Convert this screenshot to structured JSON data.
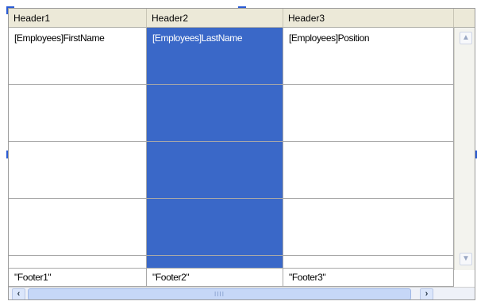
{
  "grid": {
    "headers": [
      "Header1",
      "Header2",
      "Header3"
    ],
    "detail": [
      "[Employees]FirstName",
      "[Employees]LastName",
      "[Employees]Position"
    ],
    "footers": [
      "\"Footer1\"",
      "\"Footer2\"",
      "\"Footer3\""
    ],
    "selected_column": 2
  },
  "scrollbar": {
    "up_icon": "chevron-up-icon",
    "down_icon": "chevron-down-icon",
    "left_icon": "chevron-left-icon",
    "right_icon": "chevron-right-icon",
    "grip": "IIII"
  },
  "colors": {
    "selection": "#3a68c8",
    "header_bg": "#ece9d8",
    "grid_line": "#a8a8a8",
    "handle": "#2a5bd4"
  }
}
